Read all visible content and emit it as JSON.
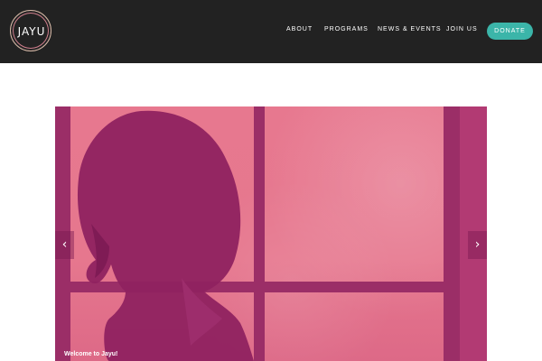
{
  "header": {
    "logo_text": "JAYU",
    "nav": [
      {
        "label": "ABOUT"
      },
      {
        "label": "PROGRAMS"
      },
      {
        "label": "NEWS & EVENTS"
      },
      {
        "label": "JOIN US"
      }
    ],
    "donate_label": "DONATE"
  },
  "hero": {
    "caption": "Welcome to Jayu!",
    "prev_icon": "chevron-left-icon",
    "next_icon": "chevron-right-icon"
  },
  "colors": {
    "header_bg": "#222222",
    "accent": "#3bb5a9",
    "overlay": "#e3728f"
  }
}
